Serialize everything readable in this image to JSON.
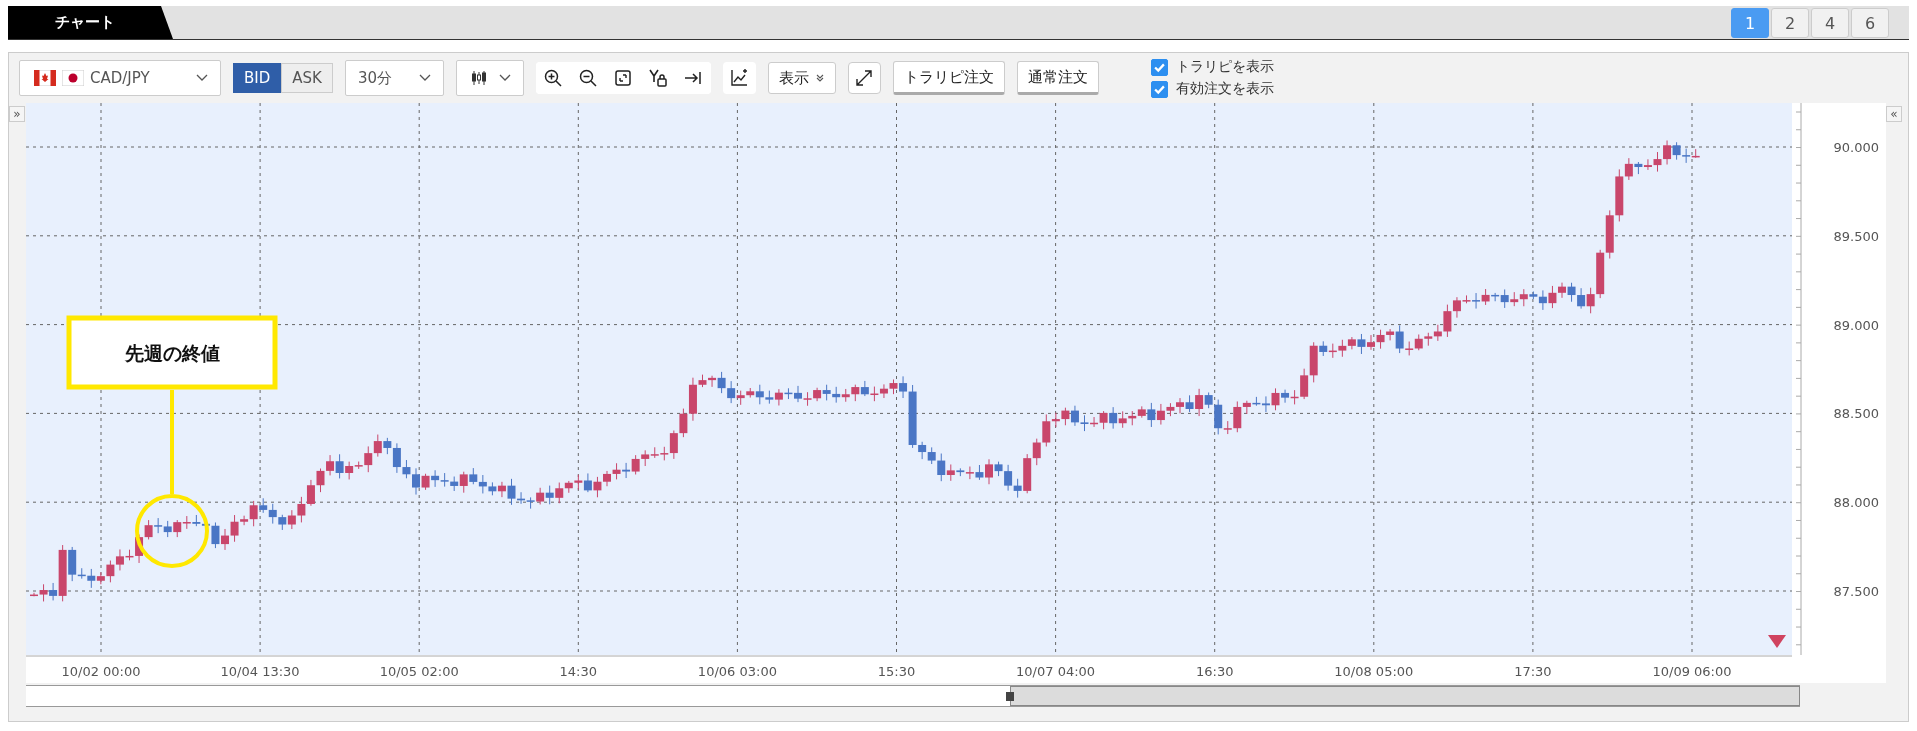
{
  "tab": {
    "label": "チャート"
  },
  "layout_buttons": [
    {
      "label": "1",
      "selected": true
    },
    {
      "label": "2",
      "selected": false
    },
    {
      "label": "4",
      "selected": false
    },
    {
      "label": "6",
      "selected": false
    }
  ],
  "toolbar": {
    "pair": "CAD/JPY",
    "price_types": [
      {
        "label": "BID",
        "selected": true
      },
      {
        "label": "ASK",
        "selected": false
      }
    ],
    "timeframe": "30分",
    "display_menu": "表示",
    "order_buttons": [
      "トラリピ注文",
      "通常注文"
    ],
    "checkboxes": [
      {
        "label": "トラリピを表示",
        "checked": true
      },
      {
        "label": "有効注文を表示",
        "checked": true
      }
    ]
  },
  "left_toggle": "»",
  "right_toggle": "«",
  "chart": {
    "y_labels": [
      "90.000",
      "89.500",
      "89.000",
      "88.500",
      "88.000",
      "87.500"
    ],
    "x_labels": [
      "10/02 00:00",
      "10/04 13:30",
      "10/05 02:00",
      "14:30",
      "10/06 03:00",
      "15:30",
      "10/07 04:00",
      "16:30",
      "10/08 05:00",
      "17:30",
      "10/09 06:00"
    ]
  },
  "callout": {
    "text": "先週の終値"
  }
}
